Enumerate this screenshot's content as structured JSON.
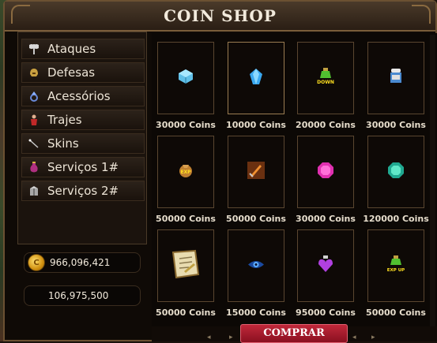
{
  "window": {
    "title": "COIN SHOP"
  },
  "sidebar": {
    "items": [
      {
        "label": "Ataques",
        "icon": "axe-icon"
      },
      {
        "label": "Defesas",
        "icon": "helmet-icon"
      },
      {
        "label": "Acessórios",
        "icon": "ring-icon"
      },
      {
        "label": "Trajes",
        "icon": "costume-icon"
      },
      {
        "label": "Skins",
        "icon": "wand-icon"
      },
      {
        "label": "Serviços 1#",
        "icon": "potion-icon"
      },
      {
        "label": "Serviços 2#",
        "icon": "box-icon"
      }
    ]
  },
  "wallet": {
    "coins": "966,096,421",
    "points": "106,975,500"
  },
  "shop": {
    "items": [
      {
        "price": "30000 Coins",
        "icon": "blue-cube-gem-icon"
      },
      {
        "price": "10000 Coins",
        "icon": "blue-crystal-icon"
      },
      {
        "price": "20000 Coins",
        "icon": "down-potion-icon",
        "icon_text": "DOWN"
      },
      {
        "price": "30000 Coins",
        "icon": "scroll-jar-icon"
      },
      {
        "price": "50000 Coins",
        "icon": "exp-pouch-icon",
        "icon_text": "EXP"
      },
      {
        "price": "50000 Coins",
        "icon": "sword-icon"
      },
      {
        "price": "30000 Coins",
        "icon": "pink-gem-icon"
      },
      {
        "price": "120000 Coins",
        "icon": "teal-gem-icon"
      },
      {
        "price": "50000 Coins",
        "icon": "parchment-icon"
      },
      {
        "price": "15000 Coins",
        "icon": "eye-icon"
      },
      {
        "price": "95000 Coins",
        "icon": "heart-potion-icon"
      },
      {
        "price": "50000 Coins",
        "icon": "exp-up-potion-icon",
        "icon_text": "EXP UP"
      }
    ]
  },
  "actions": {
    "buy_label": "COMPRAR"
  }
}
